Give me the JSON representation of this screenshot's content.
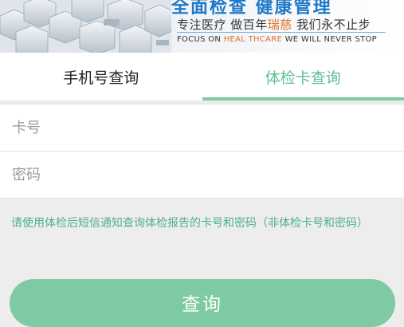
{
  "banner": {
    "headline_partial": "全面检查 健康管理",
    "slogan_cn_prefix": "专注医疗 做百年",
    "slogan_cn_accent": "瑞慈",
    "slogan_cn_suffix": " 我们永不止步",
    "slogan_en_prefix": "FOCUS ON ",
    "slogan_en_accent": "HEAL THCARE",
    "slogan_en_suffix": "   WE WILL NEVER STOP",
    "accent_color": "#e0712a"
  },
  "tabs": [
    {
      "label": "手机号查询",
      "active": false
    },
    {
      "label": "体检卡查询",
      "active": true
    }
  ],
  "form": {
    "card_placeholder": "卡号",
    "card_value": "",
    "password_placeholder": "密码",
    "password_value": "",
    "note": "请使用体检后短信通知查询体检报告的卡号和密码（非体检卡号和密码）",
    "submit_label": "查询"
  },
  "colors": {
    "primary": "#7ecaa3",
    "active_tab": "#5fbf94",
    "note_text": "#4eaf97",
    "background": "#ededed"
  }
}
